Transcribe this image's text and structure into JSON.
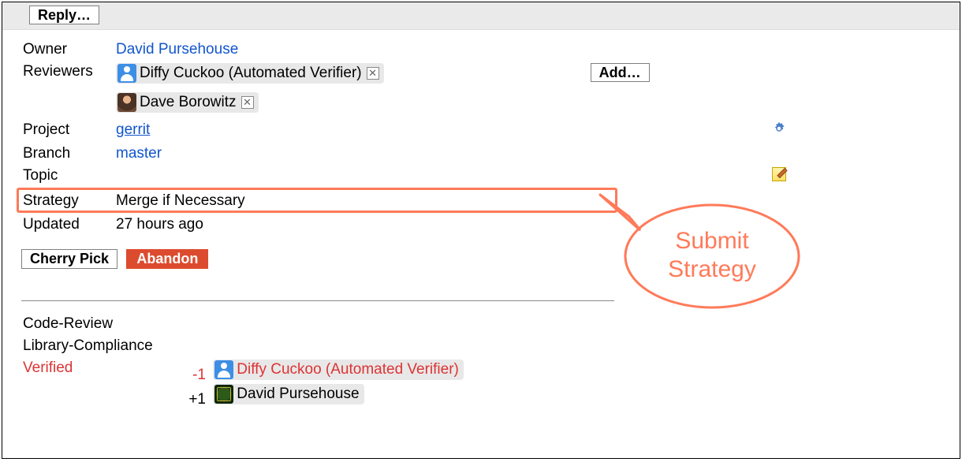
{
  "header": {
    "reply_label": "Reply…"
  },
  "info": {
    "owner_label": "Owner",
    "owner_name": "David Pursehouse",
    "reviewers_label": "Reviewers",
    "reviewers": [
      {
        "name": "Diffy Cuckoo (Automated Verifier)",
        "avatar": "blue"
      },
      {
        "name": "Dave Borowitz",
        "avatar": "photo1"
      }
    ],
    "add_label": "Add…",
    "project_label": "Project",
    "project_value": "gerrit",
    "branch_label": "Branch",
    "branch_value": "master",
    "topic_label": "Topic",
    "strategy_label": "Strategy",
    "strategy_value": "Merge if Necessary",
    "updated_label": "Updated",
    "updated_value": "27 hours ago"
  },
  "actions": {
    "cherry_pick": "Cherry Pick",
    "abandon": "Abandon"
  },
  "labels": {
    "items": [
      {
        "name": "Code-Review"
      },
      {
        "name": "Library-Compliance"
      },
      {
        "name": "Verified",
        "emphasis": true,
        "votes": [
          {
            "score": "-1",
            "who": "Diffy Cuckoo (Automated Verifier)",
            "avatar": "blue",
            "emphasis": true
          },
          {
            "score": "+1",
            "who": "David Pursehouse",
            "avatar": "green"
          }
        ]
      }
    ]
  },
  "callout": {
    "line1": "Submit",
    "line2": "Strategy"
  }
}
